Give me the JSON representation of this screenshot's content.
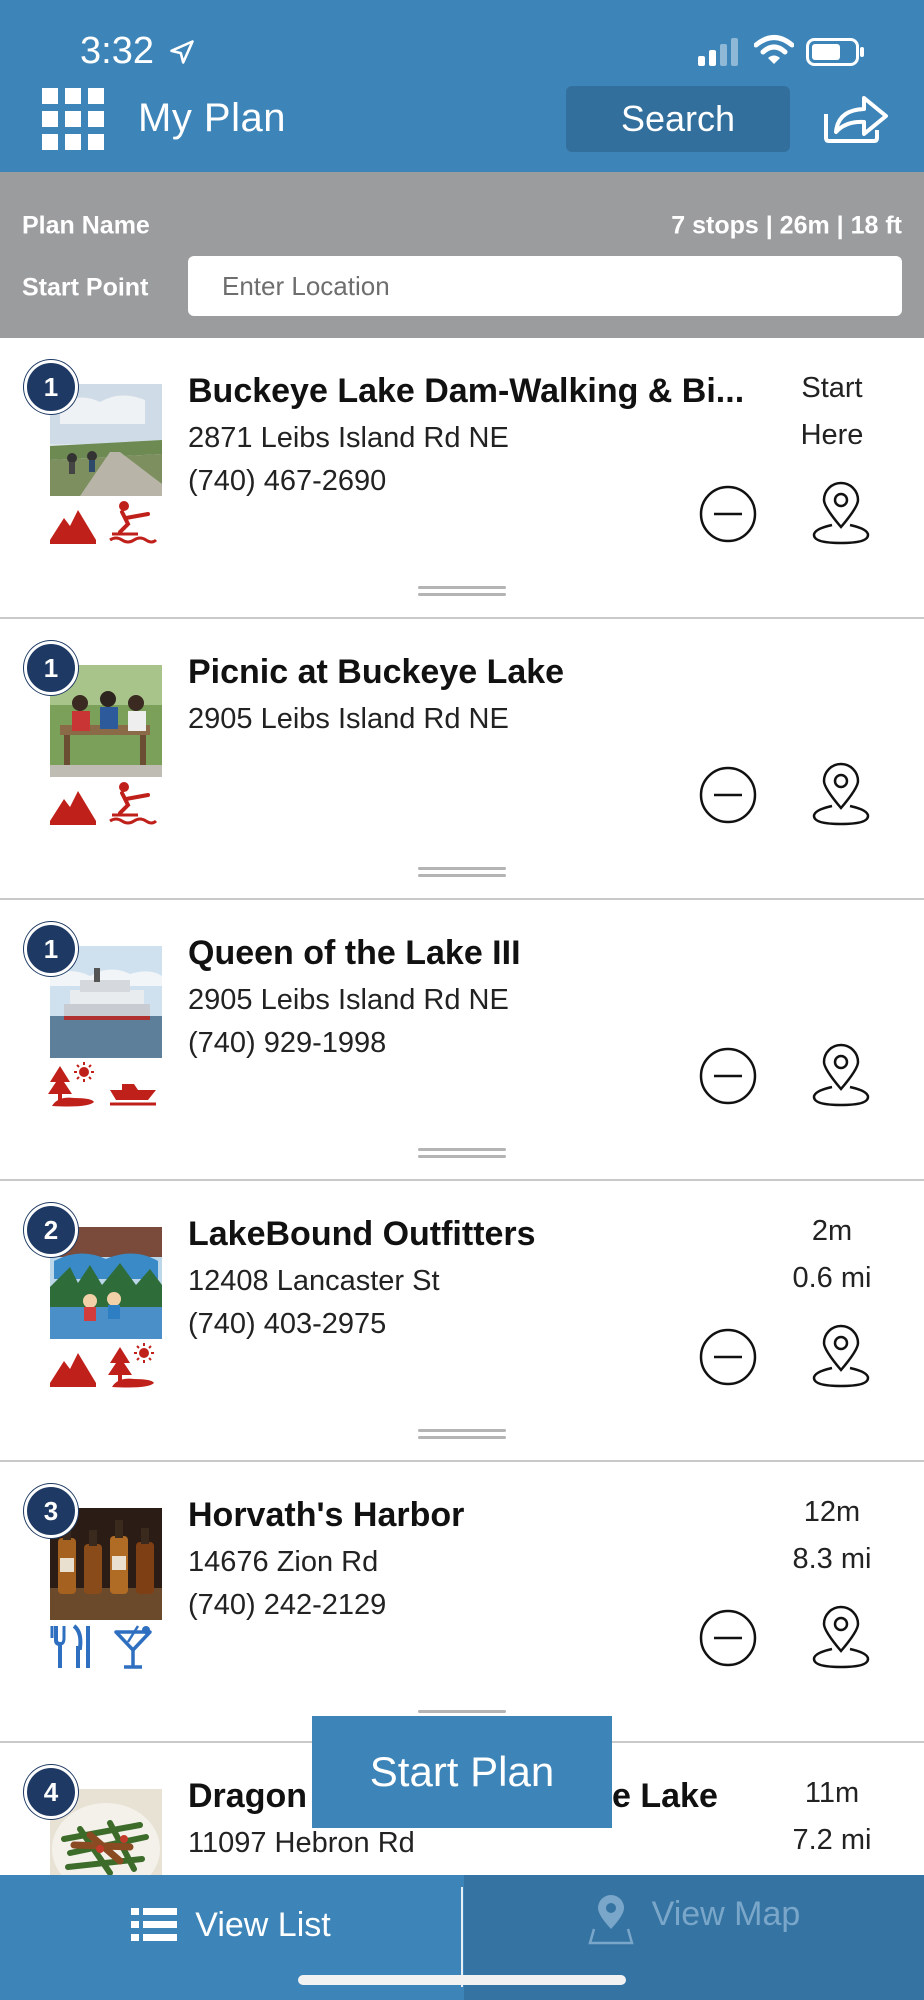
{
  "status": {
    "time": "3:32"
  },
  "header": {
    "title": "My Plan",
    "search_label": "Search"
  },
  "plan": {
    "name_label": "Plan Name",
    "stats": "7 stops | 26m | 18 ft",
    "start_point_label": "Start Point",
    "start_point_placeholder": "Enter Location"
  },
  "items": [
    {
      "number": "1",
      "title": "Buckeye Lake Dam-Walking & Bi...",
      "address": "2871 Leibs Island Rd NE",
      "phone": "(740) 467-2690",
      "meta1": "Start",
      "meta2": "Here",
      "categories": [
        "mountain-icon",
        "waterski-icon"
      ]
    },
    {
      "number": "1",
      "title": "Picnic at Buckeye Lake",
      "address": "2905 Leibs Island Rd NE",
      "phone": "",
      "meta1": "",
      "meta2": "",
      "categories": [
        "mountain-icon",
        "waterski-icon"
      ]
    },
    {
      "number": "1",
      "title": "Queen of the Lake III",
      "address": "2905 Leibs Island Rd NE",
      "phone": "(740) 929-1998",
      "meta1": "",
      "meta2": "",
      "categories": [
        "tree-sun-icon",
        "boat-icon"
      ]
    },
    {
      "number": "2",
      "title": "LakeBound Outfitters",
      "address": "12408 Lancaster St",
      "phone": "(740) 403-2975",
      "meta1": "2m",
      "meta2": "0.6 mi",
      "categories": [
        "mountain-icon",
        "tree-sun-icon"
      ]
    },
    {
      "number": "3",
      "title": "Horvath's Harbor",
      "address": "14676 Zion Rd",
      "phone": "(740) 242-2129",
      "meta1": "12m",
      "meta2": "8.3 mi",
      "categories": [
        "dining-icon",
        "cocktail-icon"
      ]
    },
    {
      "number": "4",
      "title": "Dragon",
      "title_tail": "e Lake",
      "address": "11097 Hebron Rd",
      "phone": "",
      "meta1": "11m",
      "meta2": "7.2 mi",
      "categories": []
    }
  ],
  "start_plan_label": "Start Plan",
  "tabs": {
    "list_label": "View List",
    "map_label": "View Map"
  },
  "colors": {
    "header": "#3d84b8",
    "badge": "#1e3a64",
    "category_red": "#c0201a",
    "category_blue": "#2f6fc0"
  }
}
